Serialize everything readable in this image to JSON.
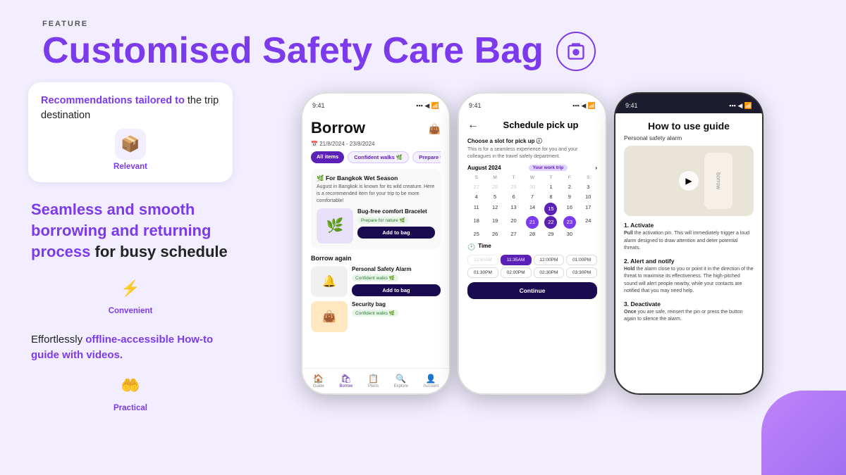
{
  "header": {
    "feature_label": "FEATURE",
    "title": "Customised Safety Care Bag"
  },
  "left_col": {
    "card1": {
      "text_normal": "the trip destination",
      "text_highlight": "Recommendations tailored to",
      "icon_emoji": "📦",
      "icon_label": "Relevant"
    },
    "card2": {
      "text_highlight": "Seamless and smooth borrowing and returning process",
      "text_normal": "for busy schedule",
      "icon_emoji": "⚡",
      "icon_label": "Convenient"
    },
    "card3": {
      "text_normal": "How-to guide with videos.",
      "text_highlight1": "Effortlessly",
      "text_highlight2": "offline-accessible",
      "icon_emoji": "🤲",
      "icon_label": "Practical"
    }
  },
  "phone1": {
    "time": "9:41",
    "title": "Borrow",
    "date_range": "21/8/2024 - 23/8/2024",
    "tags": [
      "All items",
      "Confident walks 🌿",
      "Prepare for"
    ],
    "season_title": "For Bangkok Wet Season",
    "season_desc": "August in Bangkok is known for its wild creature. Here is a recommended item for your trip to be more comfortable!",
    "item1_name": "Bug-free comfort Bracelet",
    "item1_badge": "Prepare for nature 🌿",
    "item1_btn": "Add to bag",
    "borrow_again": "Borrow again",
    "item2_name": "Personal Safety Alarm",
    "item2_badge": "Confident walks 🌿",
    "item2_btn": "Add to bag",
    "item3_name": "Security bag",
    "item3_badge": "Confident walks 🌿",
    "nav": [
      "Guide",
      "Borrow",
      "Plans",
      "Explore",
      "Account"
    ]
  },
  "phone2": {
    "time": "9:41",
    "title": "Schedule pick up",
    "choose_slot": "Choose a slot for pick up ⓘ",
    "slot_desc": "This is for a seamless experience for you and your colleagues in the travel safety department.",
    "month": "August 2024",
    "trip_badge": "Your work trip",
    "day_labels": [
      "S",
      "M",
      "T",
      "W",
      "T",
      "F",
      "S"
    ],
    "weeks": [
      [
        "27",
        "28",
        "29",
        "30",
        "1",
        "2",
        "3"
      ],
      [
        "4",
        "5",
        "6",
        "7",
        "8",
        "9",
        "10"
      ],
      [
        "11",
        "12",
        "13",
        "14",
        "15",
        "16",
        "17"
      ],
      [
        "18",
        "19",
        "20",
        "21",
        "22",
        "23",
        "24"
      ],
      [
        "25",
        "26",
        "27",
        "28",
        "29",
        "30",
        ""
      ]
    ],
    "special_days": {
      "15": "today",
      "21": "selected",
      "22": "selected",
      "23": "selected"
    },
    "time_label": "Time",
    "time_slots_row1": [
      "11:00AM",
      "11:35AM",
      "12:00PM",
      "01:00PM"
    ],
    "time_slots_row2": [
      "01:30PM",
      "02:00PM",
      "02:30PM",
      "03:30PM"
    ],
    "active_time": "11:35AM",
    "continue_btn": "Continue"
  },
  "phone3": {
    "time": "9:41",
    "title": "How to use guide",
    "subtitle": "Personal safety alarm",
    "steps": [
      {
        "number": "1.",
        "title": "Activate",
        "bold_word": "Pull",
        "desc": "the activation pin. This will immediately trigger a loud alarm designed to draw attention and deter potential threats."
      },
      {
        "number": "2.",
        "title": "Alert and notify",
        "bold_word": "Hold",
        "desc": "the alarm close to you or point it in the direction of the threat to maximise its effectiveness. The high-pitched sound will alert people nearby, while your contacts are notified that you may need help."
      },
      {
        "number": "3.",
        "title": "Deactivate",
        "bold_word": "Once",
        "desc": "you are safe, reinsert the pin or press the button again to silence the alarm."
      }
    ]
  }
}
